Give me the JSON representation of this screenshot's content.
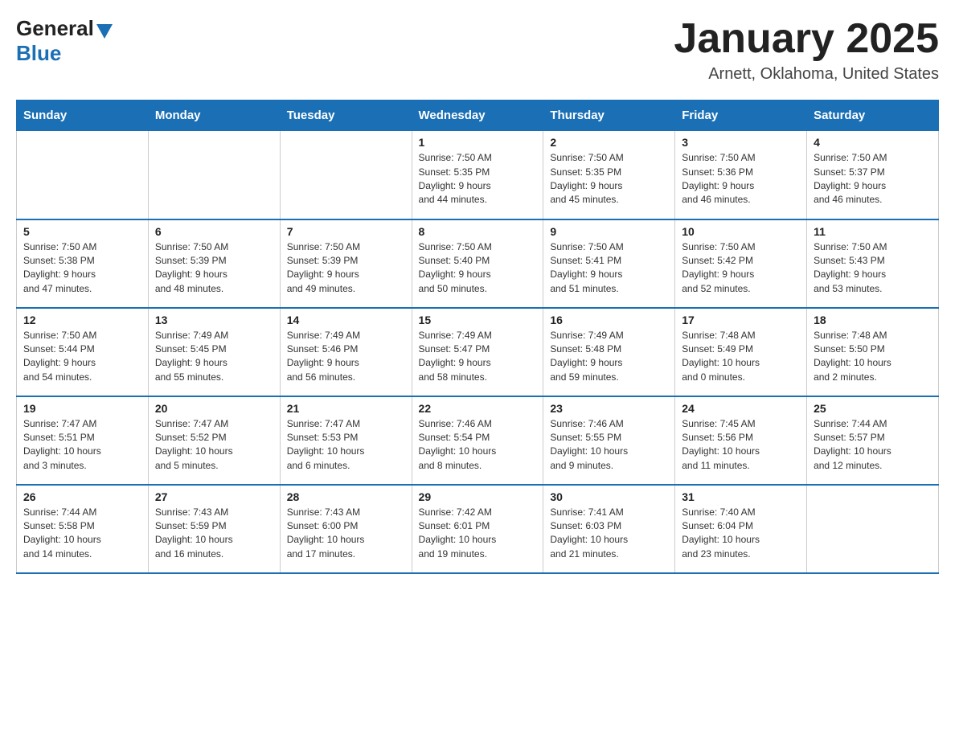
{
  "logo": {
    "general": "General",
    "blue": "Blue"
  },
  "title": "January 2025",
  "location": "Arnett, Oklahoma, United States",
  "days_of_week": [
    "Sunday",
    "Monday",
    "Tuesday",
    "Wednesday",
    "Thursday",
    "Friday",
    "Saturday"
  ],
  "weeks": [
    [
      {
        "day": "",
        "info": ""
      },
      {
        "day": "",
        "info": ""
      },
      {
        "day": "",
        "info": ""
      },
      {
        "day": "1",
        "info": "Sunrise: 7:50 AM\nSunset: 5:35 PM\nDaylight: 9 hours\nand 44 minutes."
      },
      {
        "day": "2",
        "info": "Sunrise: 7:50 AM\nSunset: 5:35 PM\nDaylight: 9 hours\nand 45 minutes."
      },
      {
        "day": "3",
        "info": "Sunrise: 7:50 AM\nSunset: 5:36 PM\nDaylight: 9 hours\nand 46 minutes."
      },
      {
        "day": "4",
        "info": "Sunrise: 7:50 AM\nSunset: 5:37 PM\nDaylight: 9 hours\nand 46 minutes."
      }
    ],
    [
      {
        "day": "5",
        "info": "Sunrise: 7:50 AM\nSunset: 5:38 PM\nDaylight: 9 hours\nand 47 minutes."
      },
      {
        "day": "6",
        "info": "Sunrise: 7:50 AM\nSunset: 5:39 PM\nDaylight: 9 hours\nand 48 minutes."
      },
      {
        "day": "7",
        "info": "Sunrise: 7:50 AM\nSunset: 5:39 PM\nDaylight: 9 hours\nand 49 minutes."
      },
      {
        "day": "8",
        "info": "Sunrise: 7:50 AM\nSunset: 5:40 PM\nDaylight: 9 hours\nand 50 minutes."
      },
      {
        "day": "9",
        "info": "Sunrise: 7:50 AM\nSunset: 5:41 PM\nDaylight: 9 hours\nand 51 minutes."
      },
      {
        "day": "10",
        "info": "Sunrise: 7:50 AM\nSunset: 5:42 PM\nDaylight: 9 hours\nand 52 minutes."
      },
      {
        "day": "11",
        "info": "Sunrise: 7:50 AM\nSunset: 5:43 PM\nDaylight: 9 hours\nand 53 minutes."
      }
    ],
    [
      {
        "day": "12",
        "info": "Sunrise: 7:50 AM\nSunset: 5:44 PM\nDaylight: 9 hours\nand 54 minutes."
      },
      {
        "day": "13",
        "info": "Sunrise: 7:49 AM\nSunset: 5:45 PM\nDaylight: 9 hours\nand 55 minutes."
      },
      {
        "day": "14",
        "info": "Sunrise: 7:49 AM\nSunset: 5:46 PM\nDaylight: 9 hours\nand 56 minutes."
      },
      {
        "day": "15",
        "info": "Sunrise: 7:49 AM\nSunset: 5:47 PM\nDaylight: 9 hours\nand 58 minutes."
      },
      {
        "day": "16",
        "info": "Sunrise: 7:49 AM\nSunset: 5:48 PM\nDaylight: 9 hours\nand 59 minutes."
      },
      {
        "day": "17",
        "info": "Sunrise: 7:48 AM\nSunset: 5:49 PM\nDaylight: 10 hours\nand 0 minutes."
      },
      {
        "day": "18",
        "info": "Sunrise: 7:48 AM\nSunset: 5:50 PM\nDaylight: 10 hours\nand 2 minutes."
      }
    ],
    [
      {
        "day": "19",
        "info": "Sunrise: 7:47 AM\nSunset: 5:51 PM\nDaylight: 10 hours\nand 3 minutes."
      },
      {
        "day": "20",
        "info": "Sunrise: 7:47 AM\nSunset: 5:52 PM\nDaylight: 10 hours\nand 5 minutes."
      },
      {
        "day": "21",
        "info": "Sunrise: 7:47 AM\nSunset: 5:53 PM\nDaylight: 10 hours\nand 6 minutes."
      },
      {
        "day": "22",
        "info": "Sunrise: 7:46 AM\nSunset: 5:54 PM\nDaylight: 10 hours\nand 8 minutes."
      },
      {
        "day": "23",
        "info": "Sunrise: 7:46 AM\nSunset: 5:55 PM\nDaylight: 10 hours\nand 9 minutes."
      },
      {
        "day": "24",
        "info": "Sunrise: 7:45 AM\nSunset: 5:56 PM\nDaylight: 10 hours\nand 11 minutes."
      },
      {
        "day": "25",
        "info": "Sunrise: 7:44 AM\nSunset: 5:57 PM\nDaylight: 10 hours\nand 12 minutes."
      }
    ],
    [
      {
        "day": "26",
        "info": "Sunrise: 7:44 AM\nSunset: 5:58 PM\nDaylight: 10 hours\nand 14 minutes."
      },
      {
        "day": "27",
        "info": "Sunrise: 7:43 AM\nSunset: 5:59 PM\nDaylight: 10 hours\nand 16 minutes."
      },
      {
        "day": "28",
        "info": "Sunrise: 7:43 AM\nSunset: 6:00 PM\nDaylight: 10 hours\nand 17 minutes."
      },
      {
        "day": "29",
        "info": "Sunrise: 7:42 AM\nSunset: 6:01 PM\nDaylight: 10 hours\nand 19 minutes."
      },
      {
        "day": "30",
        "info": "Sunrise: 7:41 AM\nSunset: 6:03 PM\nDaylight: 10 hours\nand 21 minutes."
      },
      {
        "day": "31",
        "info": "Sunrise: 7:40 AM\nSunset: 6:04 PM\nDaylight: 10 hours\nand 23 minutes."
      },
      {
        "day": "",
        "info": ""
      }
    ]
  ]
}
